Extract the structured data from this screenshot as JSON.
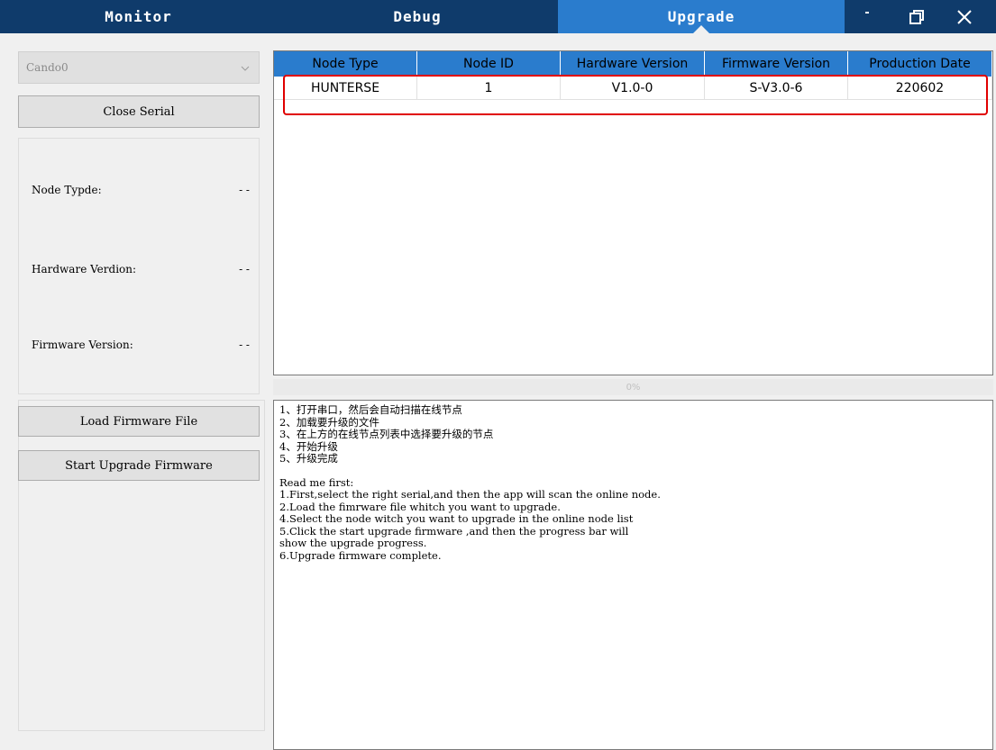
{
  "tabs": {
    "monitor": "Monitor",
    "debug": "Debug",
    "upgrade": "Upgrade"
  },
  "window_controls": {
    "minimize": "minimize-icon",
    "restore": "restore-icon",
    "close": "close-icon"
  },
  "colors": {
    "titlebar": "#0f3b6b",
    "active_tab": "#2a7ccd",
    "table_header": "#2a7ccd",
    "highlight": "#e00000"
  },
  "left": {
    "port_select": "Cando0",
    "close_serial": "Close Serial",
    "node_type_label": "Node Typde:",
    "node_type_value": "- -",
    "hardware_label": "Hardware Verdion:",
    "hardware_value": "- -",
    "firmware_label": "Firmware Version:",
    "firmware_value": "- -",
    "load_firmware": "Load Firmware File",
    "start_upgrade": "Start Upgrade Firmware"
  },
  "table": {
    "headers": [
      "Node Type",
      "Node ID",
      "Hardware Version",
      "Firmware Version",
      "Production Date"
    ],
    "rows": [
      [
        "HUNTERSE",
        "1",
        "V1.0-0",
        "S-V3.0-6",
        "220602"
      ]
    ]
  },
  "progress": {
    "label": "0%",
    "value": 0
  },
  "instructions": {
    "cn_lines": [
      "1、打开串口，然后会自动扫描在线节点",
      "2、加载要升级的文件",
      "3、在上方的在线节点列表中选择要升级的节点",
      "4、开始升级",
      "5、升级完成"
    ],
    "en_lines": [
      "Read me first:",
      "1.First,select the right serial,and then the app will scan the online node.",
      "2.Load the fimrware file whitch you want to upgrade.",
      "4.Select the node witch you want to upgrade in the online node list",
      "5.Click the start upgrade firmware ,and then the progress bar will",
      "show the upgrade progress.",
      "6.Upgrade firmware complete."
    ]
  }
}
